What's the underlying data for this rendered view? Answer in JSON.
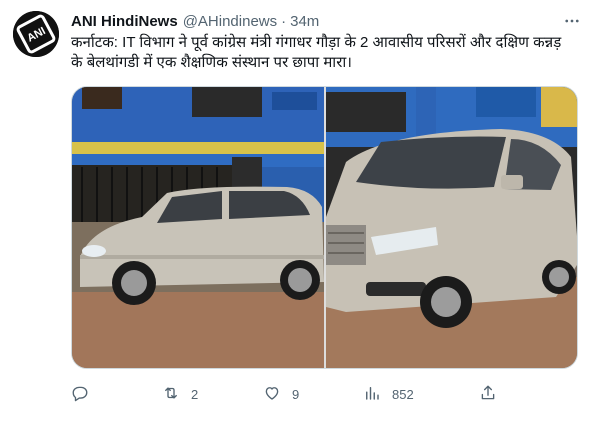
{
  "tweet": {
    "author_name": "ANI HindiNews",
    "author_handle": "@AHindinews",
    "separator": "·",
    "time": "34m",
    "text": "कर्नाटक: IT विभाग ने पूर्व कांग्रेस मंत्री गंगाधर गौड़ा के 2 आवासीय परिसरों और दक्षिण कन्नड़ के बेलथांगडी में एक शैक्षणिक संस्थान पर छापा मारा।",
    "avatar_logo_text": "ANI"
  },
  "actions": {
    "reply_count": "",
    "retweet_count": "2",
    "like_count": "9",
    "views_count": "852"
  },
  "colors": {
    "text_primary": "#0f1419",
    "text_secondary": "#536471",
    "border": "#cfd9de"
  },
  "icons": {
    "more": "more-dots-icon",
    "reply": "reply-icon",
    "retweet": "retweet-icon",
    "like": "heart-icon",
    "views": "analytics-icon",
    "share": "share-icon"
  }
}
